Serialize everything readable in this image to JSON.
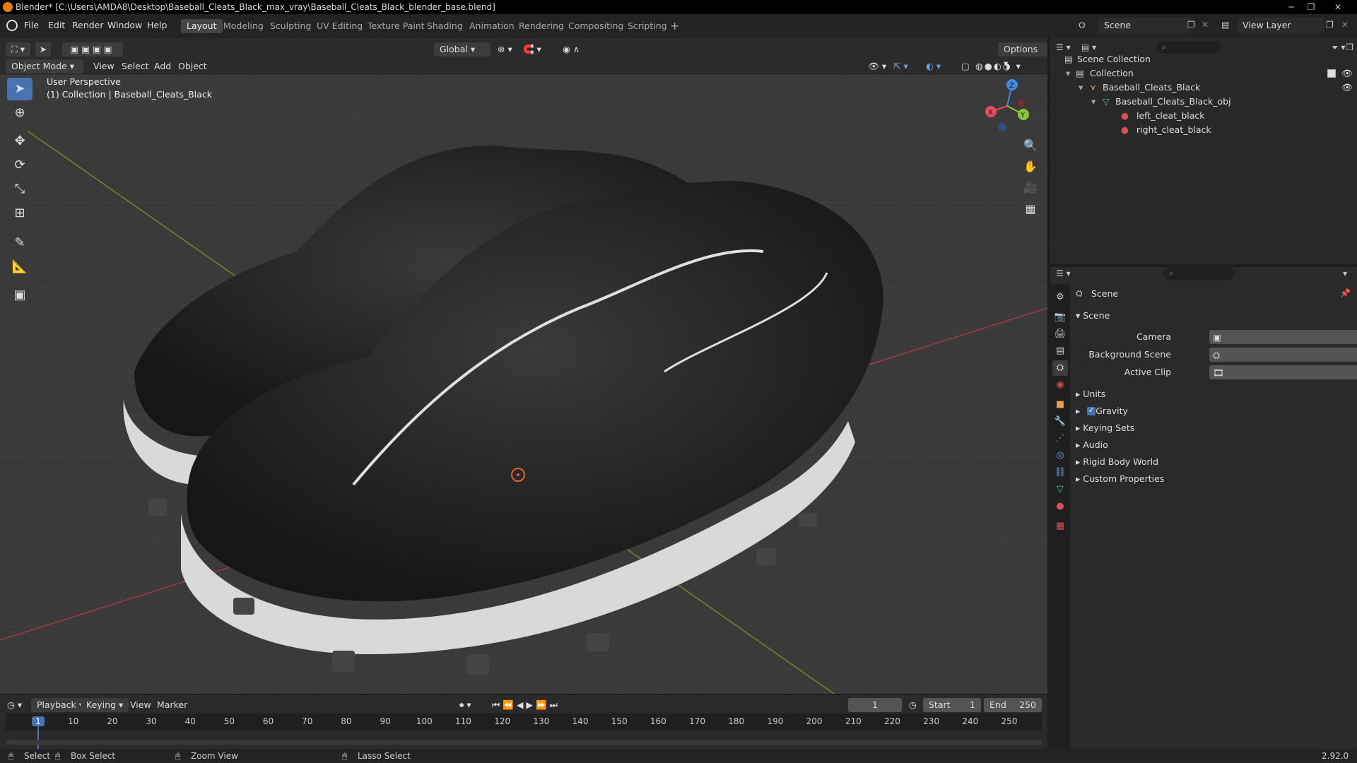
{
  "window": {
    "title": "Blender* [C:\\Users\\AMDA8\\Desktop\\Baseball_Cleats_Black_max_vray\\Baseball_Cleats_Black_blender_base.blend]"
  },
  "menu": [
    "File",
    "Edit",
    "Render",
    "Window",
    "Help"
  ],
  "workspaces": [
    "Layout",
    "Modeling",
    "Sculpting",
    "UV Editing",
    "Texture Paint",
    "Shading",
    "Animation",
    "Rendering",
    "Compositing",
    "Scripting"
  ],
  "active_workspace": "Layout",
  "scene_name": "Scene",
  "view_layer": "View Layer",
  "viewport": {
    "transform_orientation": "Global",
    "options_label": "Options",
    "mode": "Object Mode",
    "menus": [
      "View",
      "Select",
      "Add",
      "Object"
    ],
    "overlay_line1": "User Perspective",
    "overlay_line2": "(1) Collection | Baseball_Cleats_Black",
    "gizmo_axes": {
      "x": "X",
      "y": "Y",
      "z": "Z"
    }
  },
  "outliner": {
    "root": "Scene Collection",
    "items": [
      {
        "label": "Collection"
      },
      {
        "label": "Baseball_Cleats_Black"
      },
      {
        "label": "Baseball_Cleats_Black_obj"
      },
      {
        "label": "left_cleat_black"
      },
      {
        "label": "right_cleat_black"
      }
    ]
  },
  "properties": {
    "header": "Scene",
    "section": "Scene",
    "fields": [
      {
        "label": "Camera"
      },
      {
        "label": "Background Scene"
      },
      {
        "label": "Active Clip"
      }
    ],
    "panels": [
      "Units",
      "Gravity",
      "Keying Sets",
      "Audio",
      "Rigid Body World",
      "Custom Properties"
    ],
    "gravity_checked": true
  },
  "timeline": {
    "menus": [
      "Playback",
      "Keying",
      "View",
      "Marker"
    ],
    "current_frame": "1",
    "start_label": "Start",
    "start": "1",
    "end_label": "End",
    "end": "250",
    "ticks": [
      "1",
      "10",
      "20",
      "30",
      "40",
      "50",
      "60",
      "70",
      "80",
      "90",
      "100",
      "110",
      "120",
      "130",
      "140",
      "150",
      "160",
      "170",
      "180",
      "190",
      "200",
      "210",
      "220",
      "230",
      "240",
      "250"
    ]
  },
  "statusbar": {
    "select": "Select",
    "box_select": "Box Select",
    "zoom_view": "Zoom View",
    "lasso_select": "Lasso Select",
    "version": "2.92.0"
  },
  "colors": {
    "accent": "#4772b3",
    "x_axis": "#e84a5f",
    "y_axis": "#8cc43a",
    "z_axis": "#3f8de0",
    "shoe": "#2a2a2a",
    "sole": "#d9d9d9"
  }
}
